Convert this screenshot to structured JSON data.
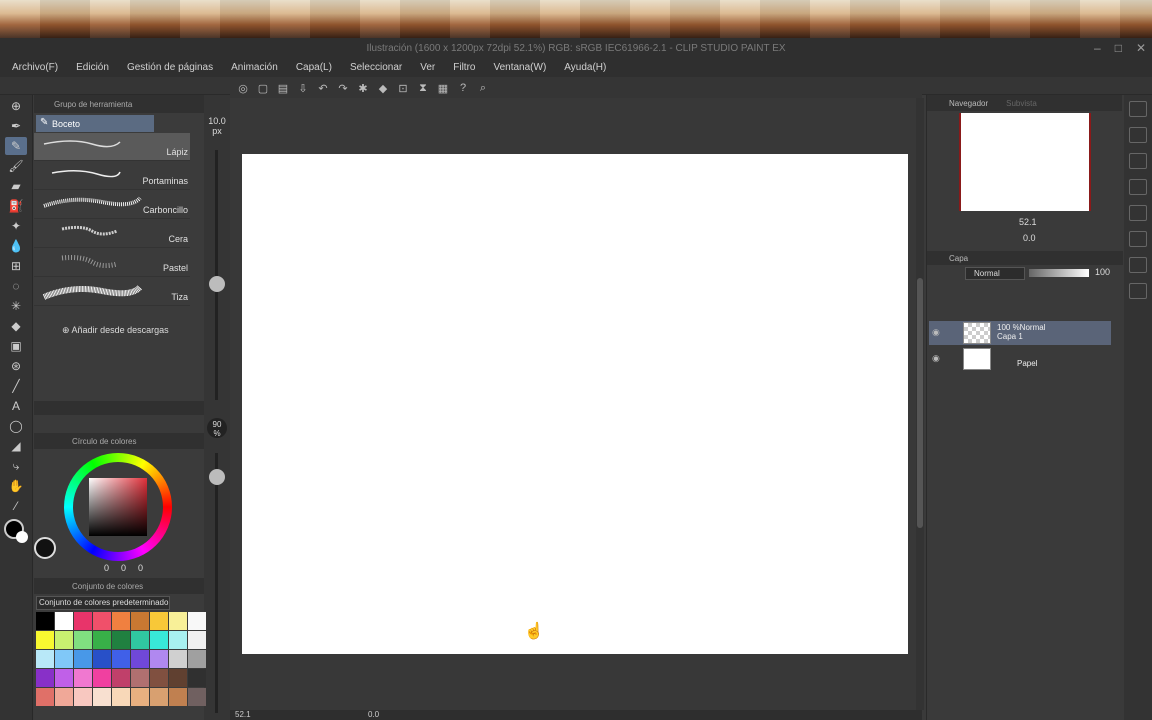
{
  "window": {
    "title": "Ilustración (1600 x 1200px 72dpi 52.1%)  RGB: sRGB IEC61966-2.1 - CLIP STUDIO PAINT EX"
  },
  "menu": [
    "Archivo(F)",
    "Edición",
    "Gestión de páginas",
    "Animación",
    "Capa(L)",
    "Seleccionar",
    "Ver",
    "Filtro",
    "Ventana(W)",
    "Ayuda(H)"
  ],
  "subtool": {
    "header": "Grupo de herramienta",
    "group": "Boceto",
    "brushes": [
      "Lápiz",
      "Portaminas",
      "Carboncillo",
      "Cera",
      "Pastel",
      "Tiza"
    ],
    "active_brush": "Lápiz",
    "add_download": "Añadir desde descargas"
  },
  "brush_size": {
    "value": "10.0",
    "unit": "px",
    "opacity": "90",
    "opacity_unit": "%"
  },
  "color_wheel": {
    "header": "Círculo de colores",
    "values": [
      "0",
      "0",
      "0"
    ]
  },
  "color_set": {
    "header": "Conjunto de colores",
    "preset": "Conjunto de colores predeterminado",
    "swatches": [
      "#000000",
      "#ffffff",
      "#e8346a",
      "#f0506a",
      "#f08040",
      "#c87832",
      "#f8c838",
      "#f8f098",
      "#f8f8f8",
      "#f8f830",
      "#c8f070",
      "#80e080",
      "#38b048",
      "#208040",
      "#30c8a0",
      "#38e8d8",
      "#a8f0f0",
      "#f0f0f0",
      "#b8e8f8",
      "#80c8f8",
      "#4898e8",
      "#2850c8",
      "#4060e8",
      "#7048d8",
      "#b088f0",
      "#d0d0d0",
      "#a0a0a0",
      "#8830c8",
      "#c060e8",
      "#f078d0",
      "#f040a0",
      "#c0406a",
      "#b07070",
      "#805040",
      "#604030",
      "#303030",
      "#e07068",
      "#f0a898",
      "#f8c8c0",
      "#f8e0d0",
      "#f8d8b8",
      "#e8b080",
      "#d8a070",
      "#c08050",
      "#706060"
    ]
  },
  "status": {
    "zoom": "52.1",
    "rotation": "0.0"
  },
  "navigator": {
    "tab": "Navegador",
    "tab2": "Subvista",
    "zoom": "52.1",
    "angle": "0.0"
  },
  "layer": {
    "tab": "Capa",
    "blend": "Normal",
    "opacity": "100",
    "layers": [
      {
        "line1": "100 %Normal",
        "line2": "Capa 1"
      },
      {
        "line1": "Papel"
      }
    ]
  }
}
